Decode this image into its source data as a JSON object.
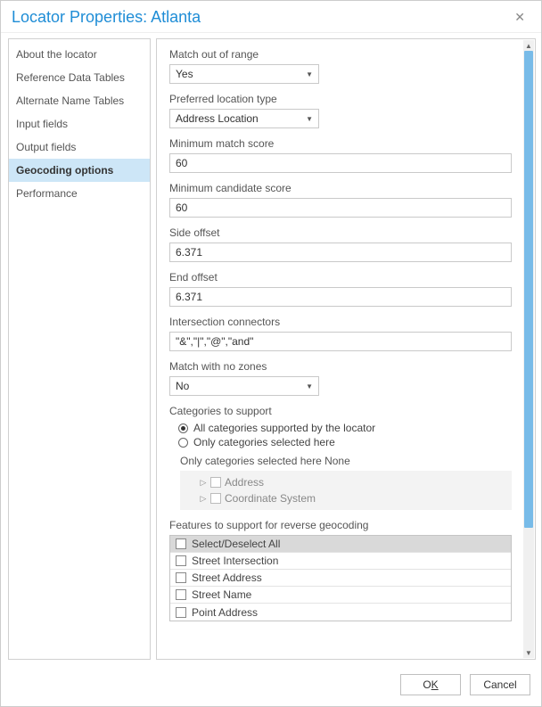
{
  "title": "Locator Properties: Atlanta",
  "sidebar": {
    "items": [
      {
        "label": "About the locator"
      },
      {
        "label": "Reference Data Tables"
      },
      {
        "label": "Alternate Name Tables"
      },
      {
        "label": "Input fields"
      },
      {
        "label": "Output fields"
      },
      {
        "label": "Geocoding options",
        "selected": true
      },
      {
        "label": "Performance"
      }
    ]
  },
  "form": {
    "match_out_of_range": {
      "label": "Match out of range",
      "value": "Yes"
    },
    "preferred_location_type": {
      "label": "Preferred location type",
      "value": "Address Location"
    },
    "minimum_match_score": {
      "label": "Minimum match score",
      "value": "60"
    },
    "minimum_candidate_score": {
      "label": "Minimum candidate score",
      "value": "60"
    },
    "side_offset": {
      "label": "Side offset",
      "value": "6.371"
    },
    "end_offset": {
      "label": "End offset",
      "value": "6.371"
    },
    "intersection_connectors": {
      "label": "Intersection connectors",
      "value": "\"&\",\"|\",\"@\",\"and\""
    },
    "match_no_zones": {
      "label": "Match with no zones",
      "value": "No"
    },
    "categories": {
      "label": "Categories to support",
      "radio_all": "All categories supported by the locator",
      "radio_selected": "Only categories selected here",
      "selected_label": "Only categories selected here None",
      "tree": [
        {
          "label": "Address"
        },
        {
          "label": "Coordinate System"
        }
      ]
    },
    "reverse": {
      "label": "Features to support for reverse geocoding",
      "header": "Select/Deselect All",
      "rows": [
        "Street Intersection",
        "Street Address",
        "Street Name",
        "Point Address"
      ]
    }
  },
  "buttons": {
    "ok_prefix": "O",
    "ok_u": "K",
    "cancel": "Cancel"
  }
}
